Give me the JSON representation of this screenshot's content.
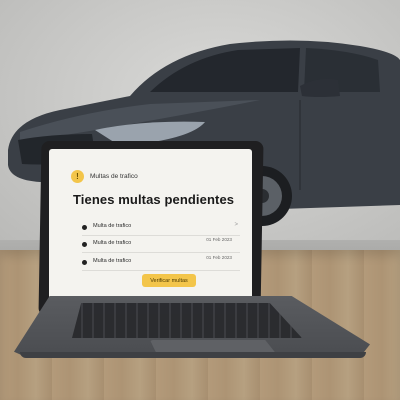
{
  "scene": {
    "car_color": "#3a3f46",
    "accent_color": "#f3c54a"
  },
  "screen": {
    "header": {
      "icon": "warning-icon",
      "icon_glyph": "!",
      "text": "Multas de trafico"
    },
    "title": "Tienes multas pendientes",
    "rows": [
      {
        "label": "Multa de trafico",
        "date": ""
      },
      {
        "label": "Multa de trafico",
        "date": "01 Feb 2023"
      },
      {
        "label": "Multa de trafico",
        "date": "01 Feb 2023"
      }
    ],
    "row_chevron": ">",
    "button_label": "Verificar multas"
  }
}
